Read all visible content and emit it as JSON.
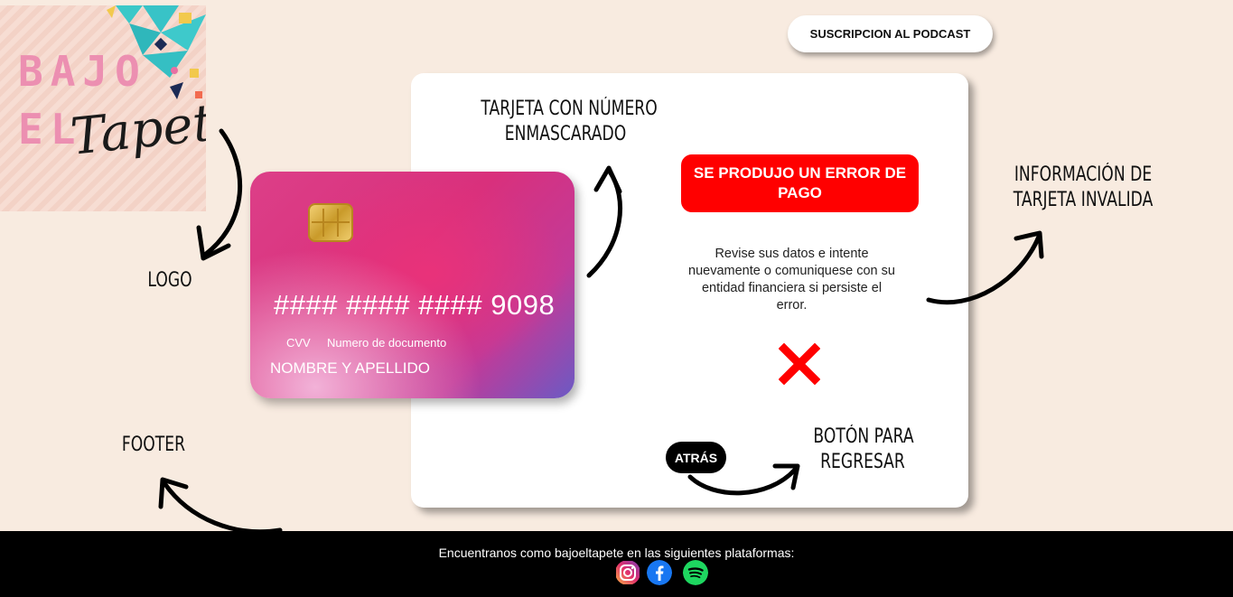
{
  "header": {
    "subscribe_label": "SUSCRIPCION AL PODCAST"
  },
  "logo": {
    "line1": "BAJO",
    "line2": "EL",
    "script": "Tapete"
  },
  "annotations": {
    "logo": "LOGO",
    "footer": "FOOTER",
    "masked_card_line1": "TARJETA CON  NÚMERO",
    "masked_card_line2": "ENMASCARADO",
    "invalid_info_line1": "INFORMACIÓN DE",
    "invalid_info_line2": "TARJETA INVALIDA",
    "back_line1": "BOTÓN PARA",
    "back_line2": "REGRESAR"
  },
  "card": {
    "number": "#### #### #### 9098",
    "cvv_label": "CVV",
    "document_label": "Numero de documento",
    "name_label": "NOMBRE Y APELLIDO"
  },
  "payment_error": {
    "title": "SE PRODUJO UN ERROR DE PAGO",
    "message": "Revise sus datos e intente nuevamente o comuniquese con su entidad financiera si persiste el error.",
    "icon": "error-x-icon",
    "color": "#ff0000"
  },
  "back_button": {
    "label": "ATRÁS"
  },
  "footer": {
    "text": "Encuentranos como bajoeltapete en las siguientes plataformas:",
    "social": [
      {
        "name": "instagram-icon"
      },
      {
        "name": "facebook-icon"
      },
      {
        "name": "spotify-icon"
      }
    ]
  }
}
